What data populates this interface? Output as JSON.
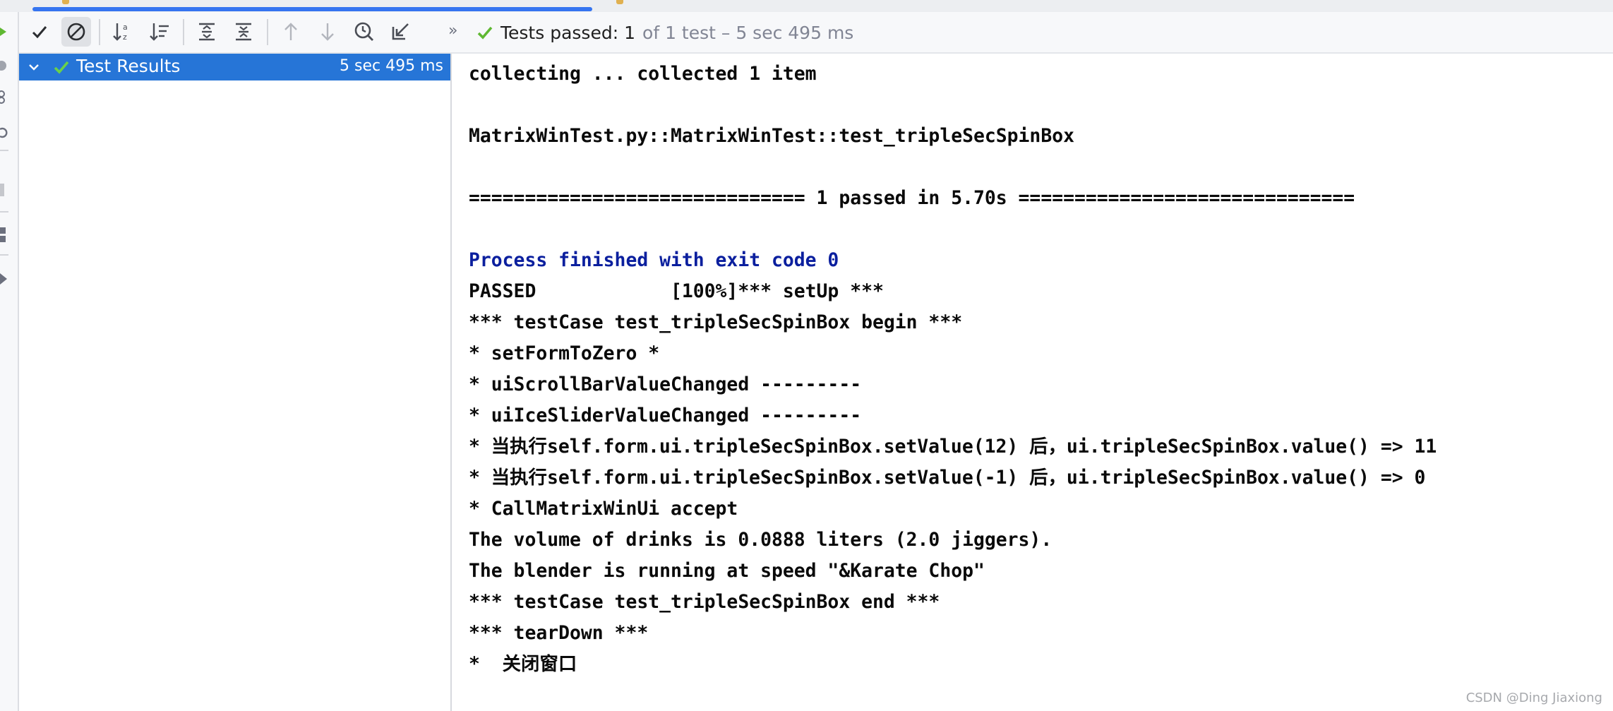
{
  "toolbar": {
    "status_prefix": "Tests passed:",
    "status_count": "1",
    "status_suffix": "of 1 test – 5 sec 495 ms",
    "more": "»"
  },
  "tree": {
    "root_label": "Test Results",
    "root_time": "5 sec 495 ms"
  },
  "console": {
    "lines": [
      "collecting ... collected 1 item",
      "",
      "MatrixWinTest.py::MatrixWinTest::test_tripleSecSpinBox",
      "",
      "============================== 1 passed in 5.70s ==============================",
      "",
      "Process finished with exit code 0",
      "PASSED            [100%]*** setUp ***",
      "*** testCase test_tripleSecSpinBox begin ***",
      "* setFormToZero *",
      "* uiScrollBarValueChanged ---------",
      "* uiIceSliderValueChanged ---------",
      "* 当执行self.form.ui.tripleSecSpinBox.setValue(12) 后，ui.tripleSecSpinBox.value() => 11",
      "* 当执行self.form.ui.tripleSecSpinBox.setValue(-1) 后，ui.tripleSecSpinBox.value() => 0",
      "* CallMatrixWinUi accept",
      "The volume of drinks is 0.0888 liters (2.0 jiggers).",
      "The blender is running at speed \"&Karate Chop\"",
      "*** testCase test_tripleSecSpinBox end ***",
      "*** tearDown ***",
      "*  关闭窗口"
    ]
  },
  "watermark": "CSDN @Ding Jiaxiong",
  "colors": {
    "accent": "#2675d7",
    "pass_green": "#5fb832",
    "system_text": "#0b1f9e"
  }
}
